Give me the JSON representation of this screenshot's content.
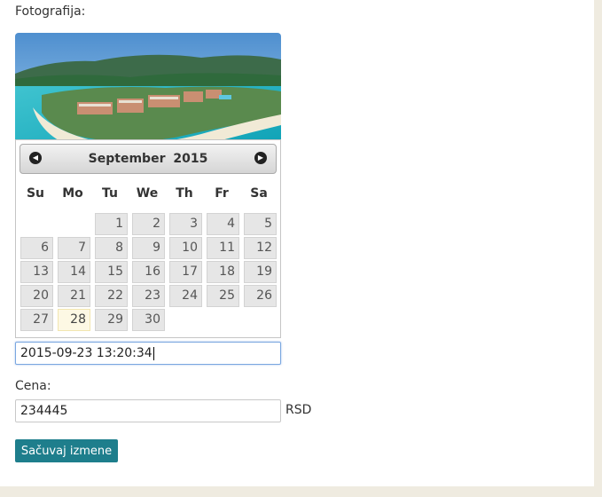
{
  "photo_section": {
    "label": "Fotografija:"
  },
  "datepicker": {
    "month": "September",
    "year": "2015",
    "prev_icon": "circle-triangle-left-icon",
    "next_icon": "circle-triangle-right-icon",
    "weekdays": [
      "Su",
      "Mo",
      "Tu",
      "We",
      "Th",
      "Fr",
      "Sa"
    ],
    "days": [
      "1",
      "2",
      "3",
      "4",
      "5",
      "6",
      "7",
      "8",
      "9",
      "10",
      "11",
      "12",
      "13",
      "14",
      "15",
      "16",
      "17",
      "18",
      "19",
      "20",
      "21",
      "22",
      "23",
      "24",
      "25",
      "26",
      "27",
      "28",
      "29",
      "30"
    ],
    "first_weekday_index": 2,
    "highlighted_day": "28"
  },
  "datetime_field": {
    "value": "2015-09-23 13:20:34"
  },
  "price": {
    "label": "Cena:",
    "value": "234445",
    "currency": "RSD"
  },
  "save_button": {
    "label": "Sačuvaj izmene"
  },
  "colors": {
    "button_bg": "#1e7e8c",
    "today_bg": "#fdf8e4",
    "focus_border": "#7aa7e0"
  }
}
